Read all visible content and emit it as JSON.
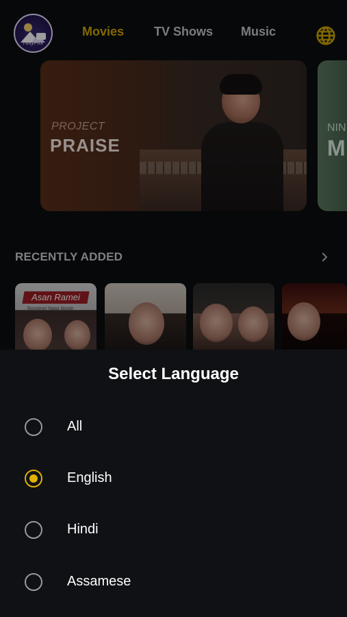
{
  "app": {
    "logo_text": "HillyFlix"
  },
  "nav": {
    "tabs": [
      {
        "label": "Movies",
        "active": true
      },
      {
        "label": "TV Shows",
        "active": false
      },
      {
        "label": "Music",
        "active": false
      }
    ],
    "accent_color": "#d1a800",
    "language_icon": "globe-icon"
  },
  "carousel": {
    "items": [
      {
        "kicker": "PROJECT",
        "title": "PRAISE"
      },
      {
        "kicker": "NIN",
        "title": "M"
      }
    ]
  },
  "recently_added": {
    "title": "RECENTLY ADDED",
    "next_icon": "chevron-right-icon",
    "thumbnails": [
      {
        "caption": "Asan Ramei",
        "subcaption": "Rongmei Naga Movie"
      },
      {
        "caption": ""
      },
      {
        "caption": ""
      },
      {
        "caption": ""
      }
    ]
  },
  "language_sheet": {
    "title": "Select Language",
    "selected": "English",
    "options": [
      "All",
      "English",
      "Hindi",
      "Assamese"
    ],
    "selected_color": "#e1b000"
  }
}
